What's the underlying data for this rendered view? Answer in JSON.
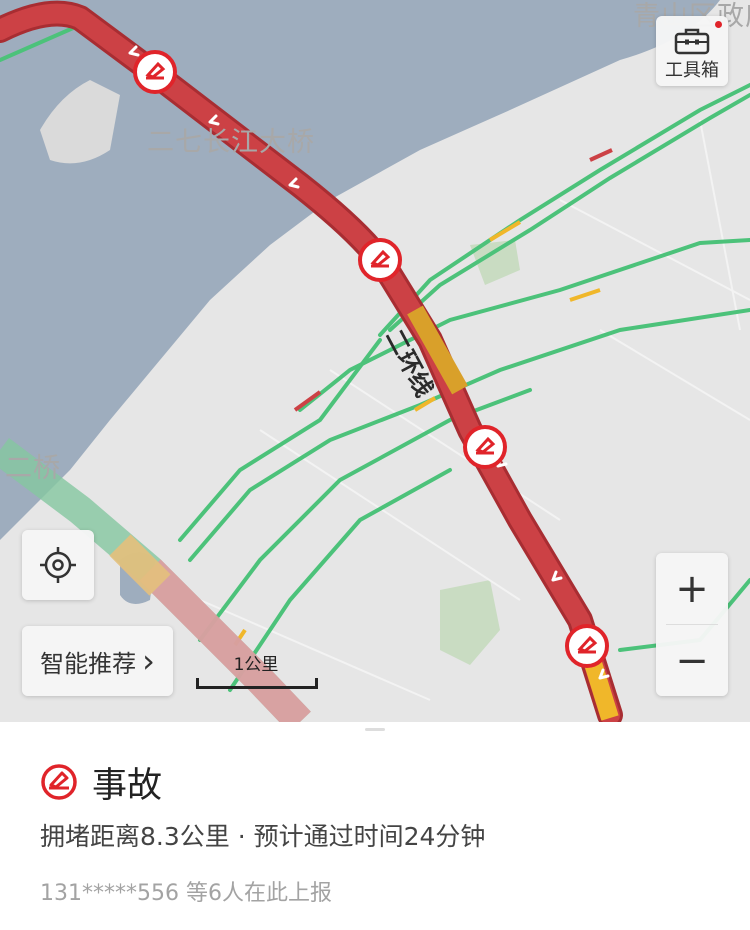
{
  "map": {
    "place_labels": {
      "bridge_1": "二七长江大桥",
      "district": "青山区政府",
      "bridge_2": "二桥"
    },
    "road_label": "二环线",
    "scale_text": "1公里",
    "colors": {
      "congestion_red": "#cc4145",
      "slow_yellow": "#f0b72a",
      "smooth_green": "#4cc27a",
      "water": "#9eadbe",
      "incident_red": "#e0242a"
    }
  },
  "controls": {
    "toolbox_label": "工具箱",
    "toolbox_icon": "toolbox-icon",
    "locate_icon": "locate-crosshair-icon",
    "recommend_label": "智能推荐",
    "recommend_arrow": "›",
    "zoom_in": "+",
    "zoom_out": "−"
  },
  "incident": {
    "icon": "accident-icon",
    "title": "事故",
    "description": "拥堵距离8.3公里 · 预计通过时间24分钟",
    "reporter": "131*****556 等6人在此上报"
  }
}
